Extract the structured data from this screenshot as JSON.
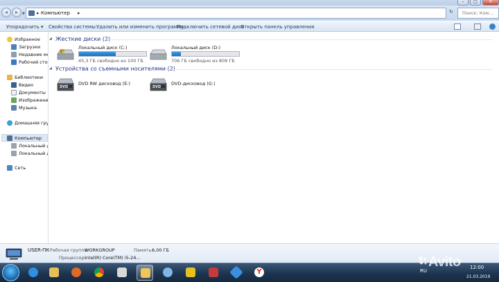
{
  "window": {
    "controls": [
      "–",
      "□",
      "✕"
    ]
  },
  "address_bar": {
    "path": "Компьютер",
    "separator": "▸",
    "search_placeholder": "Поиск: Ком..."
  },
  "toolbar": {
    "organize": "Упорядочить ▾",
    "system_properties": "Свойства системы",
    "uninstall": "Удалить или изменить программу",
    "map_drive": "Подключить сетевой диск",
    "control_panel": "Открыть панель управления"
  },
  "nav": {
    "favorites": "Избранное",
    "downloads": "Загрузки",
    "recent": "Недавние мес",
    "desktop": "Рабочий стол",
    "libraries": "Библиотеки",
    "video": "Видео",
    "documents": "Документы",
    "images": "Изображения",
    "music": "Музыка",
    "homegroup": "Домашняя груп",
    "computer": "Компьютер",
    "local_c": "Локальный ди",
    "local_d": "Локальный ди",
    "network": "Сеть"
  },
  "content": {
    "hard_disks_header": "Жесткие диски (2)",
    "removable_header": "Устройства со съемными носителями (2)",
    "drives": [
      {
        "name": "Локальный диск (C:)",
        "free": "45,3 ГБ свободно из 100 ГБ",
        "used_fraction": 0.55
      },
      {
        "name": "Локальный диск (D:)",
        "free": "706 ГБ свободно из 809 ГБ",
        "used_fraction": 0.13
      }
    ],
    "removable": [
      {
        "name": "DVD RW дисковод (E:)",
        "badge": "DVD"
      },
      {
        "name": "DVD-дисковод (G:)",
        "badge": "DVD"
      }
    ]
  },
  "details": {
    "computer_name": "USER-ПК",
    "workgroup_label": "Рабочая группа:",
    "workgroup_value": "WORKGROUP",
    "memory_label": "Память:",
    "memory_value": "6,00 ГБ",
    "cpu_label": "Процессор:",
    "cpu_value": "Intel(R) Core(TM) i5-24..."
  },
  "taskbar": {
    "lang": "RU",
    "time": "12:00",
    "date": "21.03.2019"
  },
  "watermark": "Avito",
  "colors": {
    "accent": "#1a69b6",
    "group_header": "#1e3287",
    "toolbar_text": "#1e395b"
  }
}
